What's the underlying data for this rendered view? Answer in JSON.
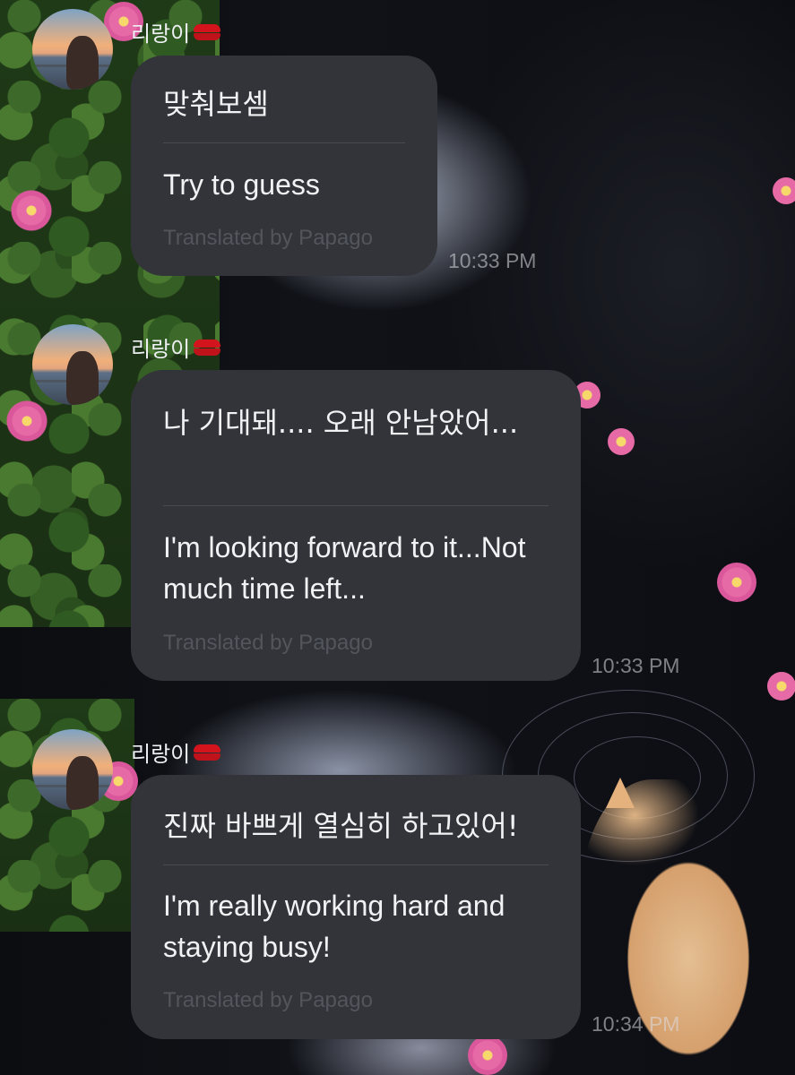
{
  "messages": [
    {
      "sender": "리랑이",
      "sender_icon": "lips-icon",
      "original": "맞춰보셈",
      "translation": "Try to guess",
      "credit": "Translated by Papago",
      "time": "10:33 PM"
    },
    {
      "sender": "리랑이",
      "sender_icon": "lips-icon",
      "original": "나 기대돼.... 오래 안남았어...",
      "translation": "I'm looking forward to it...Not much time left...",
      "credit": "Translated by Papago",
      "time": "10:33 PM"
    },
    {
      "sender": "리랑이",
      "sender_icon": "lips-icon",
      "original": "진짜 바쁘게 열심히 하고있어!",
      "translation": "I'm really working hard and staying busy!",
      "credit": "Translated by Papago",
      "time": "10:34 PM"
    }
  ],
  "colors": {
    "bubble": "#32343a",
    "text": "#f1f2f4",
    "credit": "#52555b",
    "lips": "#d4141c"
  }
}
